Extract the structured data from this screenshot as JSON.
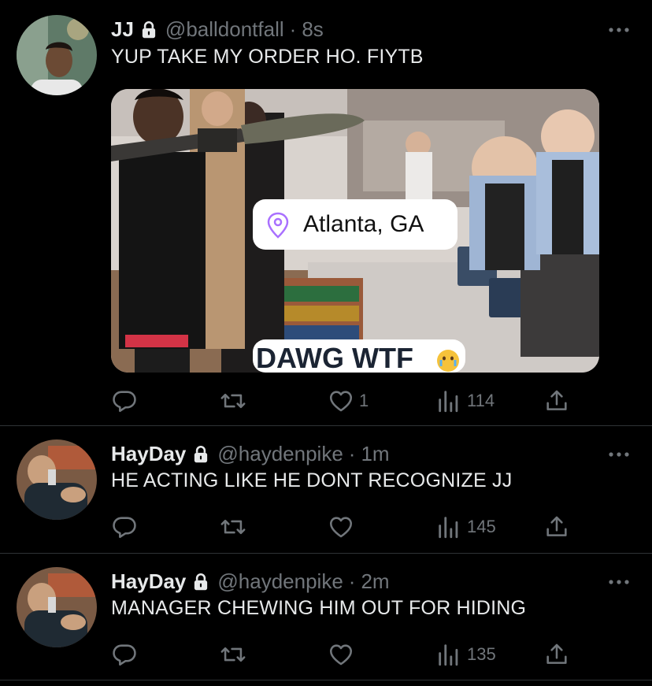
{
  "tweets": [
    {
      "name": "JJ",
      "handle": "@balldontfall",
      "sep": "·",
      "time": "8s",
      "text": "YUP TAKE MY ORDER HO. FIYTB",
      "media": {
        "location_label": "Atlanta, GA",
        "caption": "DAWG WTF"
      },
      "likes": "1",
      "views": "114"
    },
    {
      "name": "HayDay",
      "handle": "@haydenpike",
      "sep": "·",
      "time": "1m",
      "text": "HE ACTING LIKE HE DONT RECOGNIZE JJ",
      "likes": "",
      "views": "145"
    },
    {
      "name": "HayDay",
      "handle": "@haydenpike",
      "sep": "·",
      "time": "2m",
      "text": "MANAGER CHEWING HIM OUT FOR HIDING",
      "likes": "",
      "views": "135"
    }
  ],
  "colors": {
    "background": "#000000",
    "text": "#e7e9ea",
    "muted": "#71767b",
    "divider": "#2f3336",
    "location_pin": "#a970ff"
  },
  "icons": [
    "lock-icon",
    "more-icon",
    "reply-icon",
    "retweet-icon",
    "like-icon",
    "views-icon",
    "share-icon",
    "location-pin-icon",
    "crying-emoji-icon"
  ]
}
